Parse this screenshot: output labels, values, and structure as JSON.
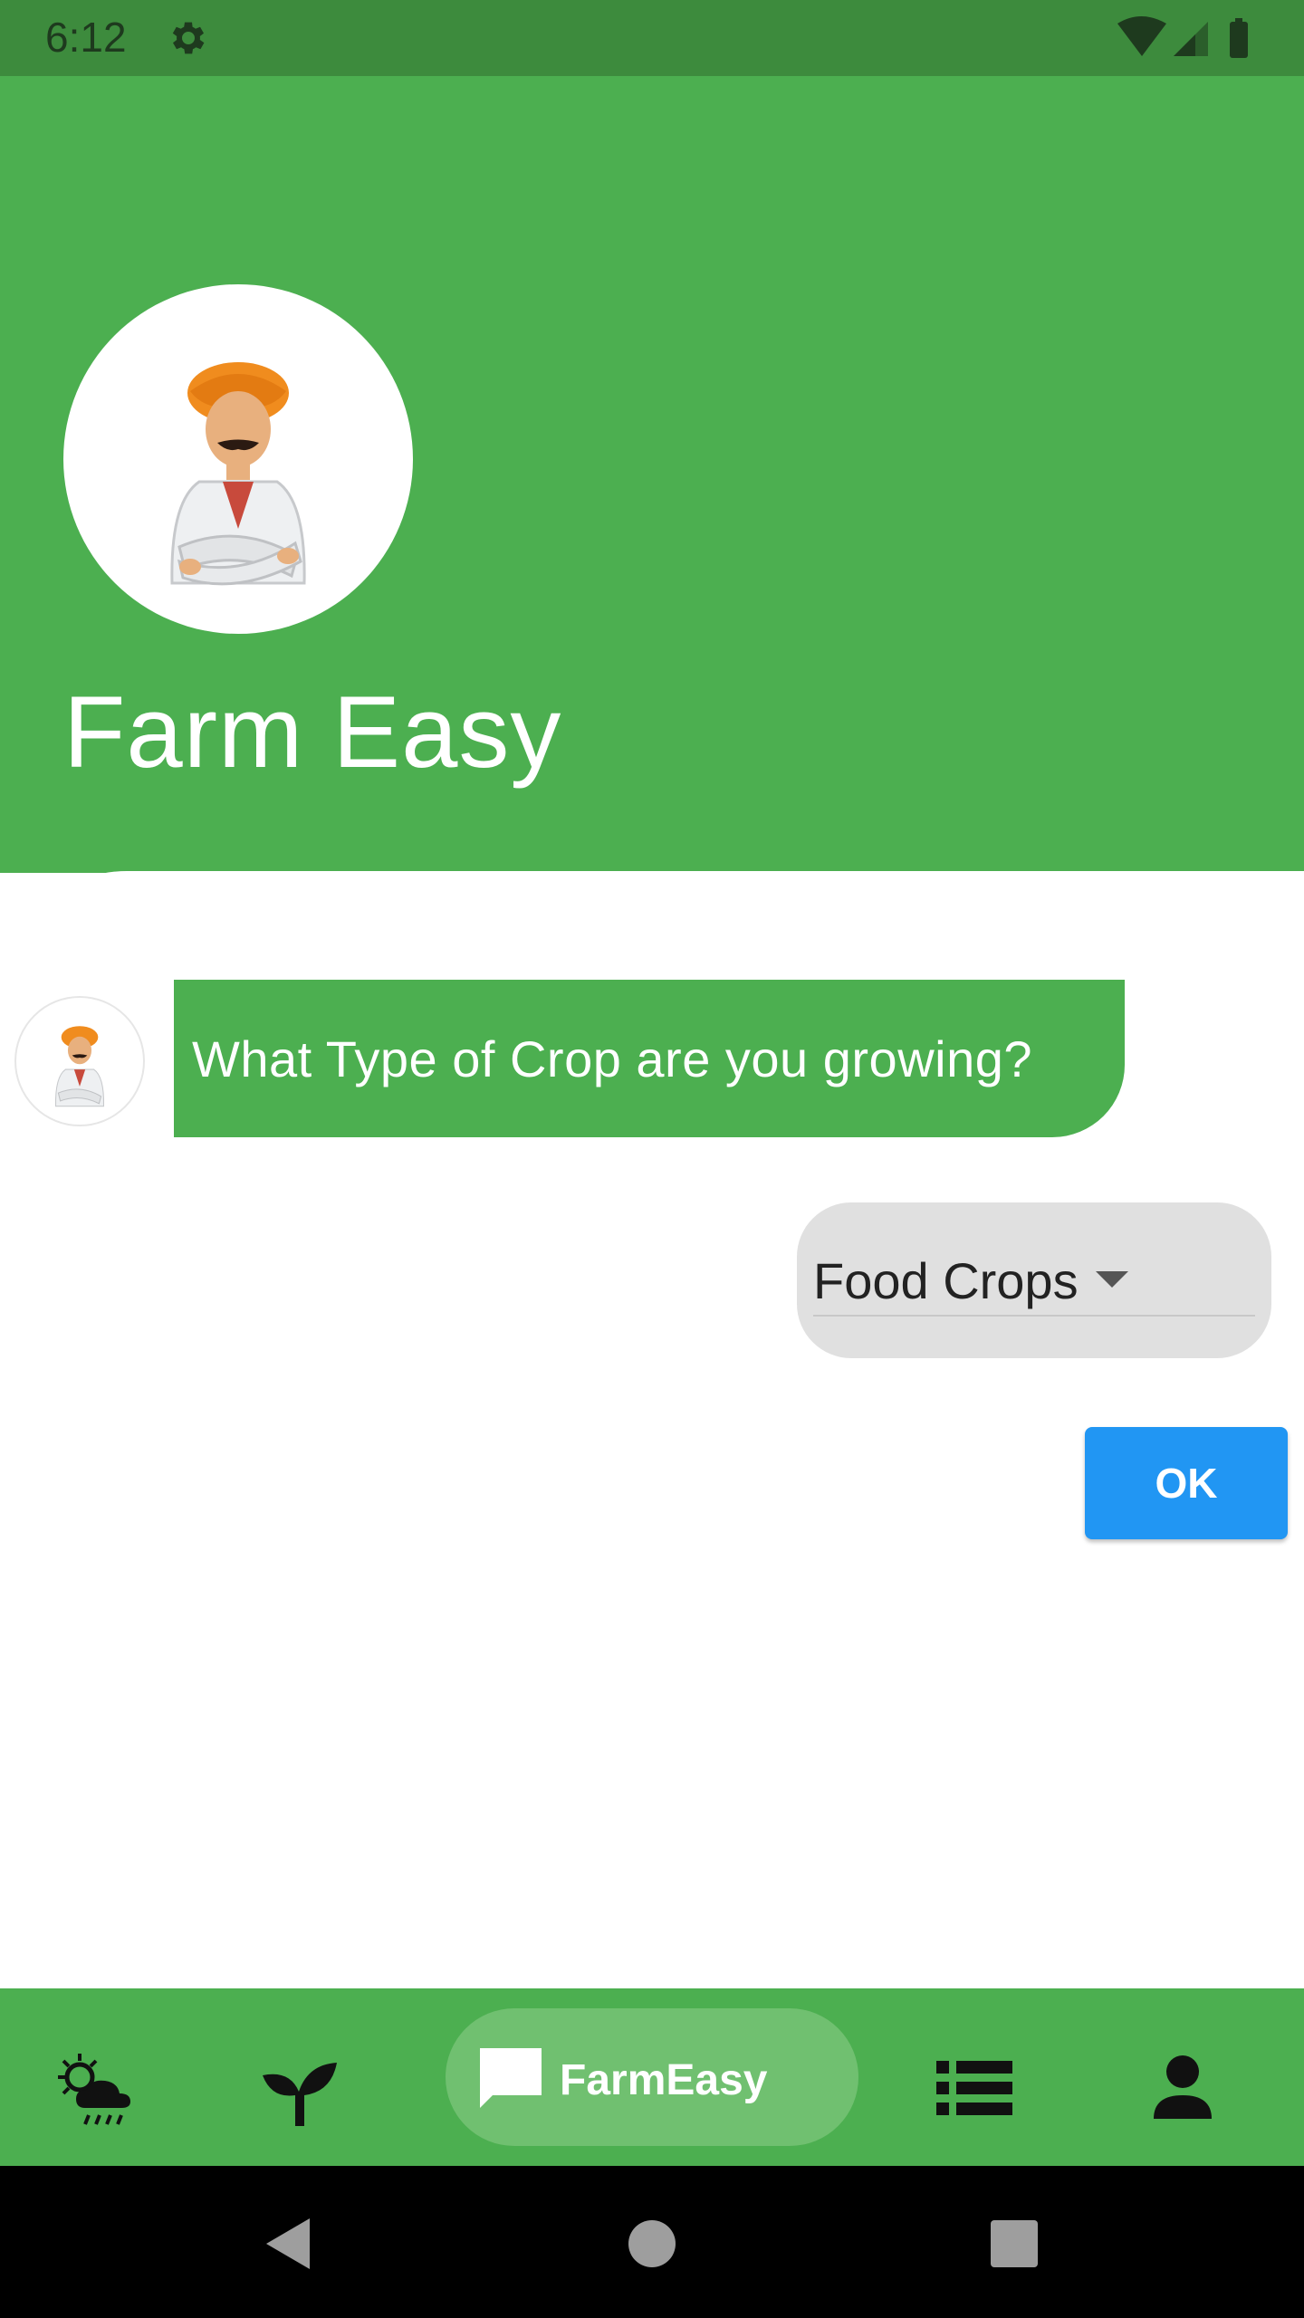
{
  "status_bar": {
    "time": "6:12",
    "settings_icon": "gear-icon",
    "wifi_icon": "wifi-icon",
    "signal_icon": "signal-icon",
    "battery_icon": "battery-icon"
  },
  "header": {
    "title": "Farm Easy",
    "avatar": "farmer-avatar"
  },
  "chat": {
    "bot_message": "What Type of Crop are you growing?",
    "crop_select": {
      "selected": "Food Crops"
    },
    "ok_label": "OK"
  },
  "bottom_nav": {
    "items": [
      {
        "icon": "weather-icon"
      },
      {
        "icon": "sprout-icon"
      },
      {
        "icon": "chat-icon",
        "label": "FarmEasy",
        "active": true
      },
      {
        "icon": "list-icon"
      },
      {
        "icon": "person-icon"
      }
    ]
  },
  "system_nav": {
    "back": "back-icon",
    "home": "home-icon",
    "recents": "recents-icon"
  },
  "colors": {
    "primary": "#4caf50",
    "status_bar": "#3d8b3d",
    "button": "#2196f3",
    "reply_bubble": "#e0e0e0"
  }
}
